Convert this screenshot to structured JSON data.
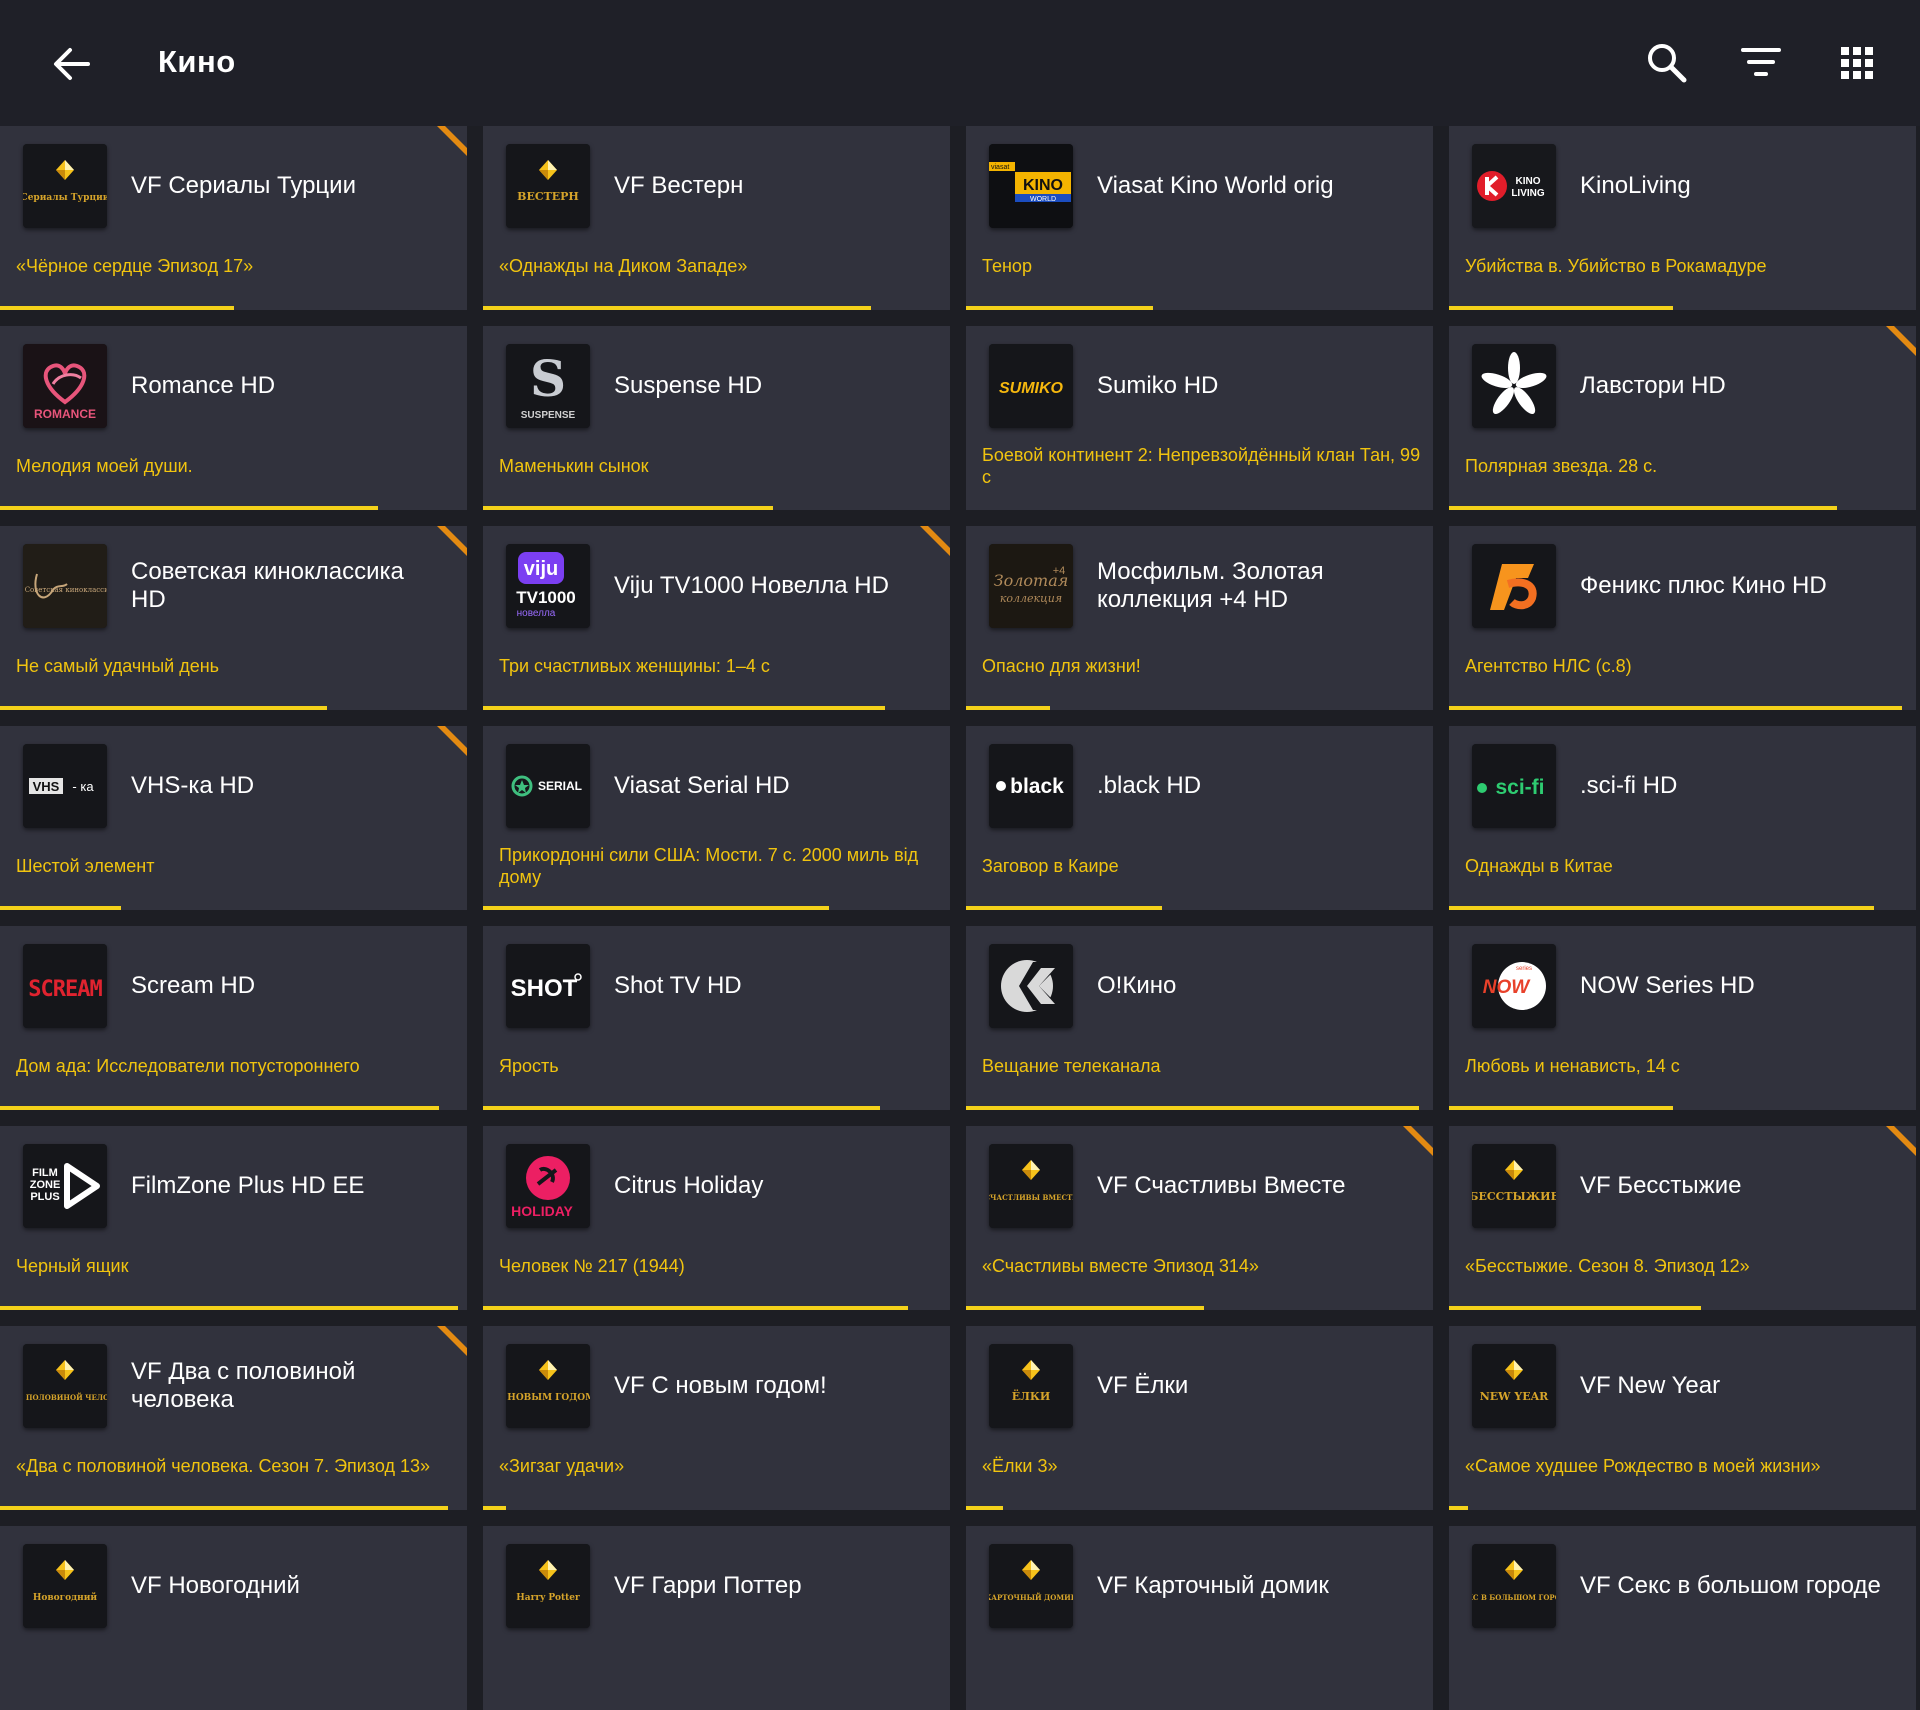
{
  "header": {
    "title": "Кино",
    "back_icon": "arrow-left-icon",
    "search_icon": "search-icon",
    "filter_icon": "filter-icon",
    "grid_icon": "grid-view-icon"
  },
  "colors": {
    "background": "#1d1e24",
    "card": "#31323d",
    "accent": "#f4d21a",
    "badge": "#e38a12",
    "program_text": "#f1c40f"
  },
  "channels": [
    {
      "name": "VF Сериалы Турции",
      "program": "«Чёрное сердце Эпизод 17»",
      "progress": 0.5,
      "badge": true,
      "logo": "vf",
      "logo_text": "Сериалы Турции"
    },
    {
      "name": "VF Вестерн",
      "program": "«Однажды на Диком Западе»",
      "progress": 0.83,
      "badge": false,
      "logo": "vf",
      "logo_text": "ВЕСТЕРН"
    },
    {
      "name": "Viasat Kino World orig",
      "program": "Тенор",
      "progress": 0.4,
      "badge": false,
      "logo": "kino",
      "logo_text": "KINO"
    },
    {
      "name": "KinoLiving",
      "program": "Убийства в. Убийство в Рокамадуре",
      "progress": 0.48,
      "badge": false,
      "logo": "kinoliving",
      "logo_text": "KINO LIVING"
    },
    {
      "name": "Romance HD",
      "program": "Мелодия моей души.",
      "progress": 0.81,
      "badge": false,
      "logo": "romance",
      "logo_text": "ROMANCE"
    },
    {
      "name": "Suspense HD",
      "program": "Маменькин сынок",
      "progress": 0.62,
      "badge": false,
      "logo": "suspense",
      "logo_text": "SUSPENSE"
    },
    {
      "name": "Sumiko HD",
      "program": "Боевой континент 2: Непревзойдённый клан Тан, 99 с",
      "progress": 0.0,
      "badge": false,
      "logo": "sumiko",
      "logo_text": "SUMIKO"
    },
    {
      "name": "Лавстори HD",
      "program": "Полярная звезда. 28 с.",
      "progress": 0.83,
      "badge": true,
      "logo": "lovestory",
      "logo_text": ""
    },
    {
      "name": "Советская киноклассика HD",
      "program": "Не самый удачный день",
      "progress": 0.7,
      "badge": true,
      "logo": "sovclass",
      "logo_text": "Советская киноклассика"
    },
    {
      "name": "Viju TV1000 Новелла HD",
      "program": "Три счастливых женщины: 1–4 с",
      "progress": 0.86,
      "badge": true,
      "logo": "viju",
      "logo_text": "viju TV1000 новелла"
    },
    {
      "name": "Мосфильм. Золотая коллекция +4 HD",
      "program": "Опасно для жизни!",
      "progress": 0.18,
      "badge": false,
      "logo": "mosfilm",
      "logo_text": "Золотая коллекция"
    },
    {
      "name": "Феникс плюс Кино HD",
      "program": "Агентство НЛС (с.8)",
      "progress": 0.97,
      "badge": false,
      "logo": "fenix",
      "logo_text": "ф"
    },
    {
      "name": "VHS-ка HD",
      "program": "Шестой элемент",
      "progress": 0.26,
      "badge": true,
      "logo": "vhs",
      "logo_text": "VHS - ка"
    },
    {
      "name": "Viasat Serial HD",
      "program": "Прикордонні сили США: Мости. 7 с. 2000 миль від дому",
      "progress": 0.74,
      "badge": false,
      "logo": "serial",
      "logo_text": "SERIAL"
    },
    {
      "name": ".black HD",
      "program": "Заговор в Каире",
      "progress": 0.42,
      "badge": false,
      "logo": "black",
      "logo_text": "black"
    },
    {
      "name": ".sci-fi HD",
      "program": "Однажды в Китае",
      "progress": 0.91,
      "badge": false,
      "logo": "scifi",
      "logo_text": "sci-fi"
    },
    {
      "name": "Scream HD",
      "program": "Дом ада: Исследователи потустороннего",
      "progress": 0.94,
      "badge": false,
      "logo": "scream",
      "logo_text": "SCREAM"
    },
    {
      "name": "Shot TV HD",
      "program": "Ярость",
      "progress": 0.85,
      "badge": false,
      "logo": "shot",
      "logo_text": "SHOT"
    },
    {
      "name": "О!Кино",
      "program": "Вещание телеканала",
      "progress": 0.97,
      "badge": false,
      "logo": "okino",
      "logo_text": ""
    },
    {
      "name": "NOW Series HD",
      "program": "Любовь и ненависть, 14 с",
      "progress": 0.48,
      "badge": false,
      "logo": "now",
      "logo_text": "NOW"
    },
    {
      "name": "FilmZone Plus HD EE",
      "program": "Черный ящик",
      "progress": 0.98,
      "badge": false,
      "logo": "filmzone",
      "logo_text": "FILM ZONE PLUS"
    },
    {
      "name": "Citrus Holiday",
      "program": "Человек № 217 (1944)",
      "progress": 0.91,
      "badge": false,
      "logo": "holiday",
      "logo_text": "HOLIDAY"
    },
    {
      "name": "VF Счастливы Вместе",
      "program": "«Счастливы вместе Эпизод 314»",
      "progress": 0.51,
      "badge": true,
      "logo": "vf",
      "logo_text": "СЧАСТЛИВЫ ВМЕСТЕ"
    },
    {
      "name": "VF Бесстыжие",
      "program": "«Бесстыжие. Сезон 8. Эпизод 12»",
      "progress": 0.54,
      "badge": true,
      "logo": "vf",
      "logo_text": "БЕССТЫЖИЕ"
    },
    {
      "name": "VF Два с половиной человека",
      "program": "«Два с половиной человека. Сезон 7. Эпизод 13»",
      "progress": 0.96,
      "badge": true,
      "logo": "vf",
      "logo_text": "ДВА С ПОЛОВИНОЙ ЧЕЛОВЕКА"
    },
    {
      "name": "VF С новым годом!",
      "program": "«Зигзаг удачи»",
      "progress": 0.05,
      "badge": false,
      "logo": "vf",
      "logo_text": "С НОВЫМ ГОДОМ!"
    },
    {
      "name": "VF Ёлки",
      "program": "«Ёлки 3»",
      "progress": 0.08,
      "badge": false,
      "logo": "vf",
      "logo_text": "ЁЛКИ"
    },
    {
      "name": "VF New Year",
      "program": "«Самое худшее Рождество в моей жизни»",
      "progress": 0.04,
      "badge": false,
      "logo": "vf",
      "logo_text": "NEW YEAR"
    },
    {
      "name": "VF Новогодний",
      "program": "",
      "progress": 0,
      "badge": false,
      "logo": "vf",
      "logo_text": "Новогодний"
    },
    {
      "name": "VF Гарри Поттер",
      "program": "",
      "progress": 0,
      "badge": false,
      "logo": "vf",
      "logo_text": "Harry Potter"
    },
    {
      "name": "VF Карточный домик",
      "program": "",
      "progress": 0,
      "badge": false,
      "logo": "vf",
      "logo_text": "КАРТОЧНЫЙ ДОМИК"
    },
    {
      "name": "VF Секс в большом городе",
      "program": "",
      "progress": 0,
      "badge": false,
      "logo": "vf",
      "logo_text": "СЕКС В БОЛЬШОМ ГОРОДЕ"
    }
  ]
}
